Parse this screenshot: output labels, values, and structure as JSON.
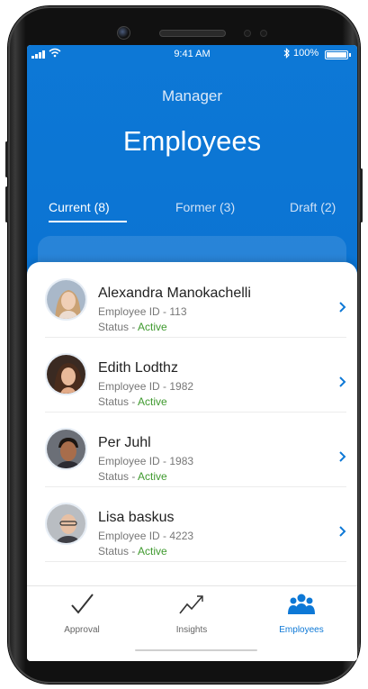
{
  "status_bar": {
    "time": "9:41 AM",
    "battery": "100%"
  },
  "header": {
    "role": "Manager",
    "title": "Employees"
  },
  "tabs": [
    {
      "label": "Current (8)",
      "active": true
    },
    {
      "label": "Former (3)",
      "active": false
    },
    {
      "label": "Draft (2)",
      "active": false
    }
  ],
  "employees": [
    {
      "name": "Alexandra Manokachelli",
      "id_line": "Employee ID - 113",
      "status_prefix": "Status - ",
      "status": "Active"
    },
    {
      "name": "Edith Lodthz",
      "id_line": "Employee ID - 1982",
      "status_prefix": "Status - ",
      "status": "Active"
    },
    {
      "name": "Per Juhl",
      "id_line": "Employee ID - 1983",
      "status_prefix": "Status - ",
      "status": "Active"
    },
    {
      "name": "Lisa baskus",
      "id_line": "Employee ID - 4223",
      "status_prefix": "Status - ",
      "status": "Active"
    }
  ],
  "nav": [
    {
      "label": "Approval",
      "icon": "checkmark-icon",
      "selected": false
    },
    {
      "label": "Insights",
      "icon": "trend-line-icon",
      "selected": false
    },
    {
      "label": "Employees",
      "icon": "people-group-icon",
      "selected": true
    }
  ],
  "colors": {
    "accent": "#0d78d6",
    "active_status": "#3f9a2e"
  }
}
